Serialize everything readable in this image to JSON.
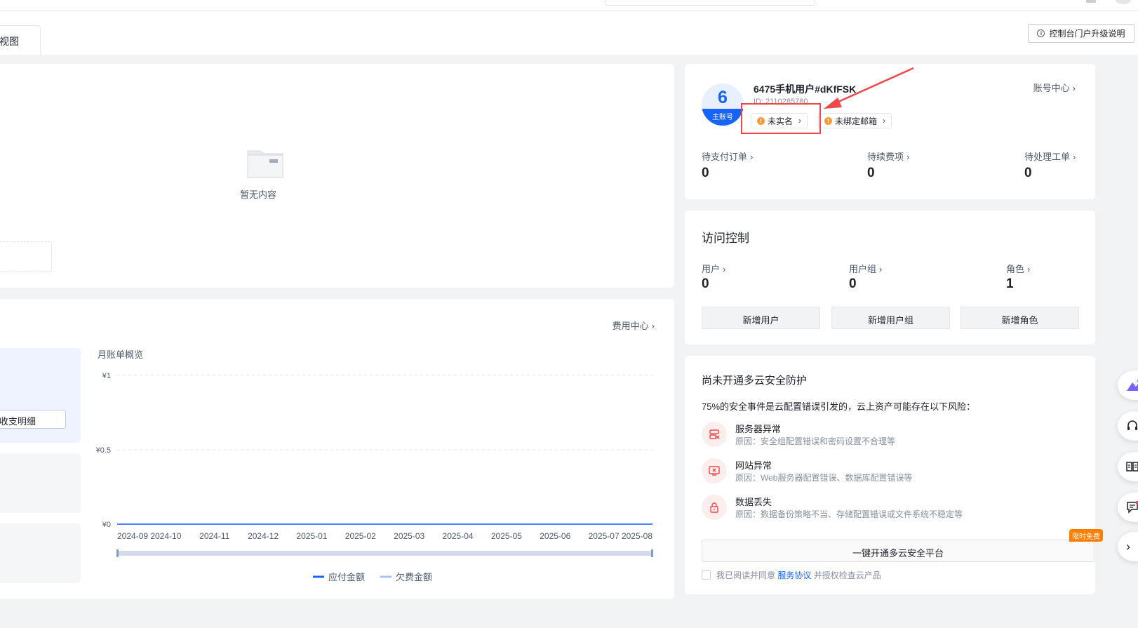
{
  "header": {
    "view_tab": "视图",
    "upgrade_label": "控制台门户升级说明"
  },
  "overview": {
    "empty_text": "暂无内容"
  },
  "billing": {
    "fee_center": "费用中心",
    "detail_btn": "收支明细",
    "chart_title": "月账单概览"
  },
  "chart_data": {
    "type": "line",
    "title": "月账单概览",
    "categories": [
      "2024-09",
      "2024-10",
      "2024-11",
      "2024-12",
      "2025-01",
      "2025-02",
      "2025-03",
      "2025-04",
      "2025-05",
      "2025-06",
      "2025-07",
      "2025-08"
    ],
    "yticks": [
      "¥1",
      "¥0.5",
      "¥0"
    ],
    "ylim": [
      0,
      1
    ],
    "grid": true,
    "legend_position": "bottom",
    "series": [
      {
        "name": "应付金额",
        "color": "#1664ff",
        "values": [
          0,
          0,
          0,
          0,
          0,
          0,
          0,
          0,
          0,
          0,
          0,
          0
        ]
      },
      {
        "name": "欠费金额",
        "color": "#a9c2ff",
        "values": [
          0,
          0,
          0,
          0,
          0,
          0,
          0,
          0,
          0,
          0,
          0,
          0
        ]
      }
    ]
  },
  "account": {
    "avatar_char": "6",
    "avatar_badge": "主账号",
    "username": "6475手机用户#dKfFSK",
    "user_id": "ID: 2110285780",
    "tag_realname": "未实名",
    "tag_email": "未绑定邮箱",
    "account_center": "账号中心",
    "stats": [
      {
        "label": "待支付订单",
        "value": "0"
      },
      {
        "label": "待续费项",
        "value": "0"
      },
      {
        "label": "待处理工单",
        "value": "0"
      }
    ]
  },
  "access": {
    "title": "访问控制",
    "stats": [
      {
        "label": "用户",
        "value": "0"
      },
      {
        "label": "用户组",
        "value": "0"
      },
      {
        "label": "角色",
        "value": "1"
      }
    ],
    "buttons": [
      "新增用户",
      "新增用户组",
      "新增角色"
    ]
  },
  "security": {
    "title": "尚未开通多云安全防护",
    "desc": "75%的安全事件是云配置错误引发的，云上资产可能存在以下风险：",
    "risks": [
      {
        "name": "服务器异常",
        "reason": "原因：安全组配置错误和密码设置不合理等"
      },
      {
        "name": "网站异常",
        "reason": "原因：Web服务器配置错误、数据库配置错误等"
      },
      {
        "name": "数据丢失",
        "reason": "原因：数据备份策略不当、存储配置错误或文件系统不稳定等"
      }
    ],
    "open_btn": "一键开通多云安全平台",
    "badge": "限时免费",
    "agree_prefix": "我已阅读并同意",
    "agree_link": "服务协议",
    "agree_suffix": "并授权检查云产品"
  },
  "icons": [
    "info-icon",
    "folder-icon",
    "chevron-right-icon",
    "warning-icon",
    "server-icon",
    "monitor-icon",
    "lock-icon",
    "ai-icon",
    "headset-icon",
    "book-icon",
    "feedback-icon",
    "arrow-right-icon"
  ]
}
